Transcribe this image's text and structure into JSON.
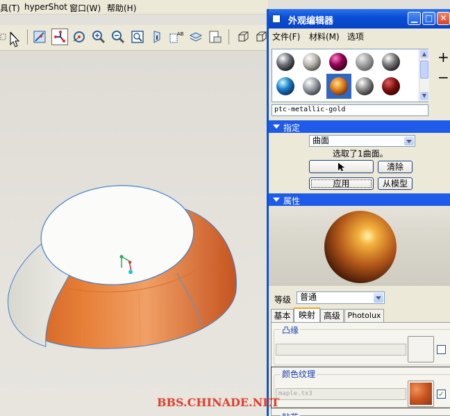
{
  "menubar": {
    "items": [
      "具(T)",
      "hyperShot",
      "窗口(W)",
      "帮助(H)"
    ]
  },
  "dialog": {
    "title": "外观编辑器",
    "menu": [
      "文件(F)",
      "材料(M)",
      "选项"
    ],
    "library": {
      "add_label": "+",
      "remove_label": "−",
      "selected_material": "ptc-metallic-gold"
    },
    "assign": {
      "header": "指定",
      "type_value": "曲面",
      "status": "选取了1曲面。",
      "clear_label": "清除",
      "apply_label": "应用",
      "from_model_label": "从模型"
    },
    "properties": {
      "header": "属性",
      "level_label": "等级",
      "level_value": "普通",
      "tabs": [
        "基本",
        "映射",
        "高级",
        "Photolux"
      ],
      "active_tab": "映射",
      "bump_label": "凸缘",
      "color_texture_label": "颜色纹理",
      "color_texture_file": "maple.tx3",
      "next_label": "贴花"
    }
  },
  "watermark": "BBS.CHINADE.NET",
  "colors": {
    "title_blue": "#0a4fd6",
    "section_blue": "#1e5be8",
    "watermark": "#e33d2a"
  }
}
